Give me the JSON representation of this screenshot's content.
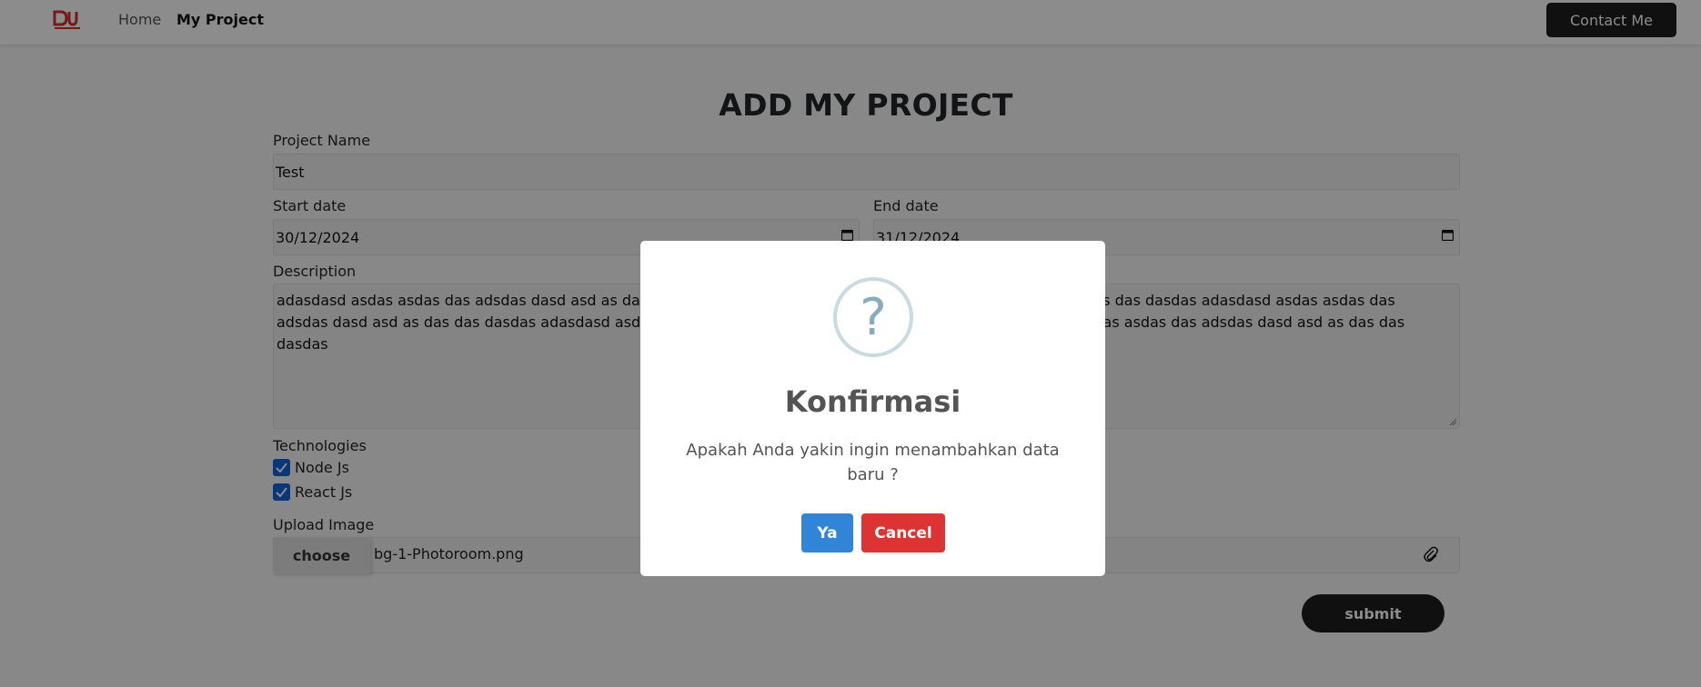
{
  "navbar": {
    "logo_text": "DW",
    "links": [
      {
        "label": "Home"
      },
      {
        "label": "My Project"
      }
    ],
    "contact_label": "Contact Me"
  },
  "form": {
    "title": "ADD MY PROJECT",
    "project_name_label": "Project Name",
    "project_name_value": "Test",
    "start_date_label": "Start date",
    "start_date_value": "30/12/2024",
    "end_date_label": "End date",
    "end_date_value": "31/12/2024",
    "description_label": "Description",
    "description_value": "adasdasd asdas asdas das adsdas dasd asd as das das dasdas adasdasd asdas asdas das adsdas dasd asd as das das dasdas adasdasd asdas asdas das adsdas dasd asd as das das dasdas adasdasd asdas asdas das adsdas dasd asd as das das dasdas adasdasd asdas asdas das adsdas dasd asd as das das dasdas",
    "technologies_label": "Technologies",
    "technologies": [
      {
        "label": "Node Js",
        "checked": true
      },
      {
        "label": "React Js",
        "checked": true
      }
    ],
    "upload_label": "Upload Image",
    "choose_label": "choose",
    "file_name": "bg-1-Photoroom.png",
    "submit_label": "submit"
  },
  "dialog": {
    "icon_glyph": "?",
    "title": "Konfirmasi",
    "message": "Apakah Anda yakin ingin menambahkan data baru ?",
    "confirm_label": "Ya",
    "cancel_label": "Cancel",
    "confirm_color": "#3085d6",
    "cancel_color": "#dd3333"
  }
}
